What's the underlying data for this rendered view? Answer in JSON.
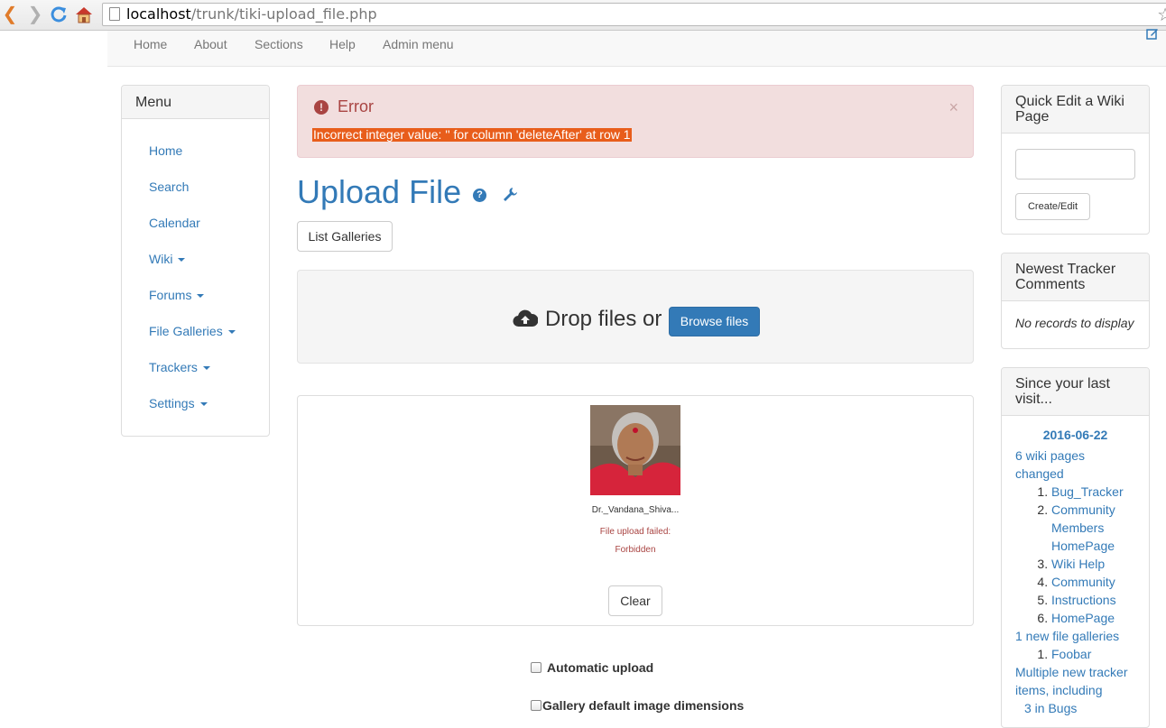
{
  "browser": {
    "url_host": "localhost",
    "url_path": "/trunk/tiki-upload_file.php"
  },
  "topnav": {
    "items": [
      "Home",
      "About",
      "Sections",
      "Help",
      "Admin menu"
    ]
  },
  "menu": {
    "title": "Menu",
    "items": [
      "Home",
      "Search",
      "Calendar",
      "Wiki",
      "Forums",
      "File Galleries",
      "Trackers",
      "Settings"
    ]
  },
  "alert": {
    "title": "Error",
    "close": "×",
    "message": "Incorrect integer value: '' for column 'deleteAfter' at row 1"
  },
  "page": {
    "title": "Upload File",
    "list_galleries": "List Galleries"
  },
  "dropzone": {
    "text": "Drop files or",
    "browse": "Browse files"
  },
  "preview": {
    "filename": "Dr._Vandana_Shiva...",
    "error_line1": "File upload failed:",
    "error_line2": "Forbidden",
    "clear": "Clear"
  },
  "options": {
    "auto_upload": "Automatic upload",
    "gallery_dims": "Gallery default image dimensions"
  },
  "quick_edit": {
    "title": "Quick Edit a Wiki Page",
    "button": "Create/Edit"
  },
  "tracker_comments": {
    "title": "Newest Tracker Comments",
    "empty": "No records to display"
  },
  "since_visit": {
    "title": "Since your last visit...",
    "date": "2016-06-22",
    "wiki_changed": "6 wiki pages changed",
    "wiki_pages": [
      "Bug_Tracker",
      "Community Members HomePage",
      "Wiki Help",
      "Community",
      "Instructions",
      "HomePage"
    ],
    "galleries_label": "1 new file galleries",
    "galleries": [
      "Foobar"
    ],
    "trackers_label": "Multiple new tracker items, including",
    "trackers_item": "3 in Bugs"
  },
  "colors": {
    "link": "#337ab7",
    "alert_text": "#a94442",
    "alert_bg": "#f2dede",
    "primary_button": "#337ab7"
  }
}
